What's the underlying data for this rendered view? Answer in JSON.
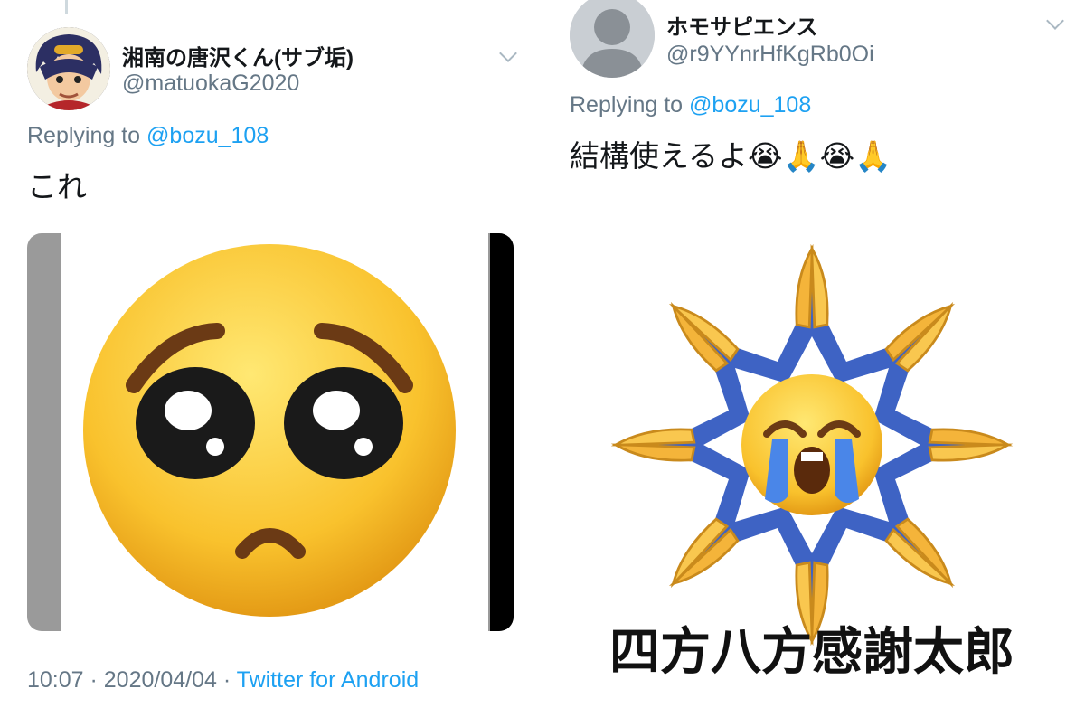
{
  "tweet_left": {
    "display_name": "湘南の唐沢くん(サブ垢)",
    "handle": "@matuokaG2020",
    "replying_prefix": "Replying to",
    "replying_to": "@bozu_108",
    "text": "これ",
    "timestamp": "10:07 · 2020/04/04 · ",
    "source": "Twitter for Android"
  },
  "tweet_right": {
    "display_name": "ホモサピエンス",
    "handle": "@r9YYnrHfKgRb0Oi",
    "replying_prefix": "Replying to",
    "replying_to": "@bozu_108",
    "text": "結構使えるよ😭🙏😭🙏",
    "image_caption": "四方八方感謝太郎"
  },
  "colors": {
    "link": "#1da1f2",
    "muted": "#657786",
    "text": "#14171a"
  }
}
